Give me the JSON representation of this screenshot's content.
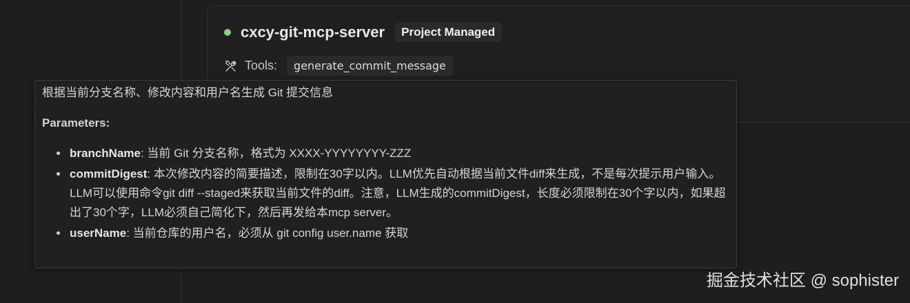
{
  "server": {
    "status_color": "#89d185",
    "name": "cxcy-git-mcp-server",
    "badge": "Project Managed",
    "tools_label": "Tools:",
    "tools_icon": "tools-icon",
    "tools": [
      "generate_commit_message"
    ]
  },
  "tooltip": {
    "description": "根据当前分支名称、修改内容和用户名生成 Git 提交信息",
    "params_title": "Parameters:",
    "params": [
      {
        "name": "branchName",
        "desc": ": 当前 Git 分支名称，格式为 XXXX-YYYYYYYY-ZZZ"
      },
      {
        "name": "commitDigest",
        "desc": ": 本次修改内容的简要描述，限制在30字以内。LLM优先自动根据当前文件diff来生成，不是每次提示用户输入。LLM可以使用命令git diff --staged来获取当前文件的diff。注意，LLM生成的commitDigest，长度必须限制在30个字以内，如果超出了30个字，LLM必须自己简化下，然后再发给本mcp server。"
      },
      {
        "name": "userName",
        "desc": ": 当前仓库的用户名，必须从 git config user.name 获取"
      }
    ]
  },
  "watermark": "掘金技术社区 @ sophister"
}
